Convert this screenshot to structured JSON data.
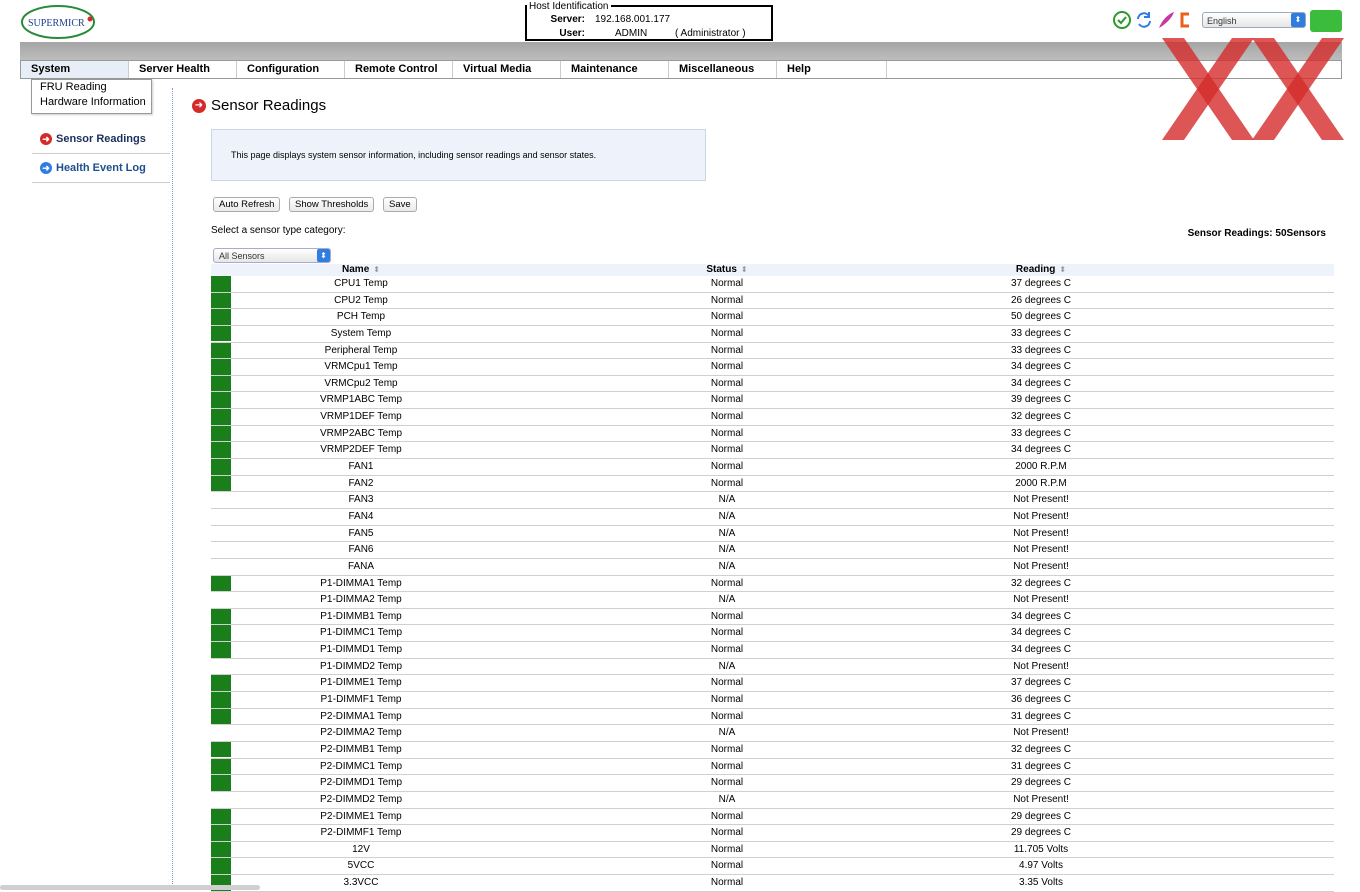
{
  "header": {
    "logo_text": "SUPERMICR",
    "host": {
      "legend": "Host Identification",
      "server_label": "Server:",
      "server_value": "192.168.001.177",
      "user_label": "User:",
      "user_value": "ADMIN",
      "user_role": "( Administrator )"
    },
    "language": "English",
    "icons": [
      "check-circle-icon",
      "refresh-icon",
      "feather-icon",
      "logout-icon"
    ]
  },
  "menu": {
    "items": [
      "System",
      "Server Health",
      "Configuration",
      "Remote Control",
      "Virtual Media",
      "Maintenance",
      "Miscellaneous",
      "Help"
    ],
    "dropdown": [
      "FRU Reading",
      "Hardware Information"
    ]
  },
  "sidebar": {
    "items": [
      {
        "label": "Sensor Readings"
      },
      {
        "label": "Health Event Log"
      }
    ]
  },
  "content": {
    "title": "Sensor Readings",
    "info": "This page displays system sensor information, including sensor readings and sensor states.",
    "buttons": {
      "auto_refresh": "Auto Refresh",
      "show_thresholds": "Show Thresholds",
      "save": "Save"
    },
    "select_label": "Select a sensor type category:",
    "select_value": "All Sensors",
    "sensor_count": "Sensor Readings: 50Sensors"
  },
  "table": {
    "headers": {
      "name": "Name",
      "status": "Status",
      "reading": "Reading"
    },
    "rows": [
      {
        "ok": true,
        "name": "CPU1 Temp",
        "status": "Normal",
        "reading": "37 degrees C"
      },
      {
        "ok": true,
        "name": "CPU2 Temp",
        "status": "Normal",
        "reading": "26 degrees C"
      },
      {
        "ok": true,
        "name": "PCH Temp",
        "status": "Normal",
        "reading": "50 degrees C"
      },
      {
        "ok": true,
        "name": "System Temp",
        "status": "Normal",
        "reading": "33 degrees C"
      },
      {
        "ok": true,
        "name": "Peripheral Temp",
        "status": "Normal",
        "reading": "33 degrees C"
      },
      {
        "ok": true,
        "name": "VRMCpu1 Temp",
        "status": "Normal",
        "reading": "34 degrees C"
      },
      {
        "ok": true,
        "name": "VRMCpu2 Temp",
        "status": "Normal",
        "reading": "34 degrees C"
      },
      {
        "ok": true,
        "name": "VRMP1ABC Temp",
        "status": "Normal",
        "reading": "39 degrees C"
      },
      {
        "ok": true,
        "name": "VRMP1DEF Temp",
        "status": "Normal",
        "reading": "32 degrees C"
      },
      {
        "ok": true,
        "name": "VRMP2ABC Temp",
        "status": "Normal",
        "reading": "33 degrees C"
      },
      {
        "ok": true,
        "name": "VRMP2DEF Temp",
        "status": "Normal",
        "reading": "34 degrees C"
      },
      {
        "ok": true,
        "name": "FAN1",
        "status": "Normal",
        "reading": "2000 R.P.M"
      },
      {
        "ok": true,
        "name": "FAN2",
        "status": "Normal",
        "reading": "2000 R.P.M"
      },
      {
        "ok": false,
        "name": "FAN3",
        "status": "N/A",
        "reading": "Not Present!"
      },
      {
        "ok": false,
        "name": "FAN4",
        "status": "N/A",
        "reading": "Not Present!"
      },
      {
        "ok": false,
        "name": "FAN5",
        "status": "N/A",
        "reading": "Not Present!"
      },
      {
        "ok": false,
        "name": "FAN6",
        "status": "N/A",
        "reading": "Not Present!"
      },
      {
        "ok": false,
        "name": "FANA",
        "status": "N/A",
        "reading": "Not Present!"
      },
      {
        "ok": true,
        "name": "P1-DIMMA1 Temp",
        "status": "Normal",
        "reading": "32 degrees C"
      },
      {
        "ok": false,
        "name": "P1-DIMMA2 Temp",
        "status": "N/A",
        "reading": "Not Present!"
      },
      {
        "ok": true,
        "name": "P1-DIMMB1 Temp",
        "status": "Normal",
        "reading": "34 degrees C"
      },
      {
        "ok": true,
        "name": "P1-DIMMC1 Temp",
        "status": "Normal",
        "reading": "34 degrees C"
      },
      {
        "ok": true,
        "name": "P1-DIMMD1 Temp",
        "status": "Normal",
        "reading": "34 degrees C"
      },
      {
        "ok": false,
        "name": "P1-DIMMD2 Temp",
        "status": "N/A",
        "reading": "Not Present!"
      },
      {
        "ok": true,
        "name": "P1-DIMME1 Temp",
        "status": "Normal",
        "reading": "37 degrees C"
      },
      {
        "ok": true,
        "name": "P1-DIMMF1 Temp",
        "status": "Normal",
        "reading": "36 degrees C"
      },
      {
        "ok": true,
        "name": "P2-DIMMA1 Temp",
        "status": "Normal",
        "reading": "31 degrees C"
      },
      {
        "ok": false,
        "name": "P2-DIMMA2 Temp",
        "status": "N/A",
        "reading": "Not Present!"
      },
      {
        "ok": true,
        "name": "P2-DIMMB1 Temp",
        "status": "Normal",
        "reading": "32 degrees C"
      },
      {
        "ok": true,
        "name": "P2-DIMMC1 Temp",
        "status": "Normal",
        "reading": "31 degrees C"
      },
      {
        "ok": true,
        "name": "P2-DIMMD1 Temp",
        "status": "Normal",
        "reading": "29 degrees C"
      },
      {
        "ok": false,
        "name": "P2-DIMMD2 Temp",
        "status": "N/A",
        "reading": "Not Present!"
      },
      {
        "ok": true,
        "name": "P2-DIMME1 Temp",
        "status": "Normal",
        "reading": "29 degrees C"
      },
      {
        "ok": true,
        "name": "P2-DIMMF1 Temp",
        "status": "Normal",
        "reading": "29 degrees C"
      },
      {
        "ok": true,
        "name": "12V",
        "status": "Normal",
        "reading": "11.705 Volts"
      },
      {
        "ok": true,
        "name": "5VCC",
        "status": "Normal",
        "reading": "4.97 Volts"
      },
      {
        "ok": true,
        "name": "3.3VCC",
        "status": "Normal",
        "reading": "3.35 Volts"
      }
    ]
  },
  "colors": {
    "ok_indicator": "#1a7f1a",
    "accent_red": "#d42a2a",
    "accent_blue": "#2f7de1",
    "info_bg": "#eef3fb"
  }
}
